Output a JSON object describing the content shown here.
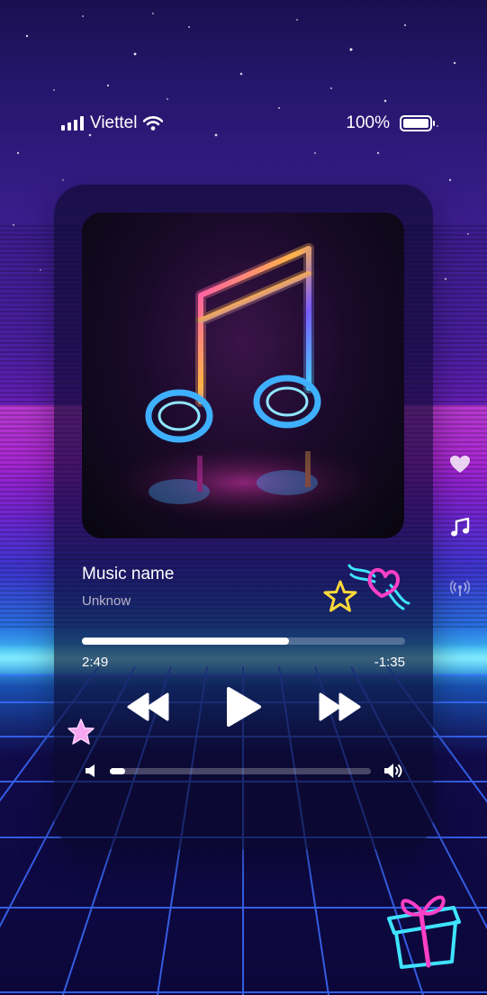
{
  "status_bar": {
    "carrier": "Viettel",
    "battery": "100%",
    "icons": [
      "signal-icon",
      "wifi-icon",
      "battery-icon"
    ]
  },
  "player": {
    "track_title": "Music name",
    "artist": "Unknow",
    "progress_fraction": 0.64,
    "time_elapsed": "2:49",
    "time_remaining": "-1:35",
    "volume_fraction": 0.06,
    "controls": [
      "rewind-icon",
      "play-icon",
      "fast-forward-icon"
    ]
  },
  "side_icons": [
    "heart-icon",
    "music-note-icon",
    "broadcast-icon"
  ],
  "decorations": [
    "neon-heart-sticker",
    "neon-star-sticker",
    "pink-star-sticker",
    "neon-gift-sticker"
  ],
  "colors": {
    "accent_pink": "#ff3fc7",
    "accent_cyan": "#3fe3ff",
    "neon_yellow": "#ffd93a",
    "card_bg": "rgba(10,8,40,0.62)"
  }
}
